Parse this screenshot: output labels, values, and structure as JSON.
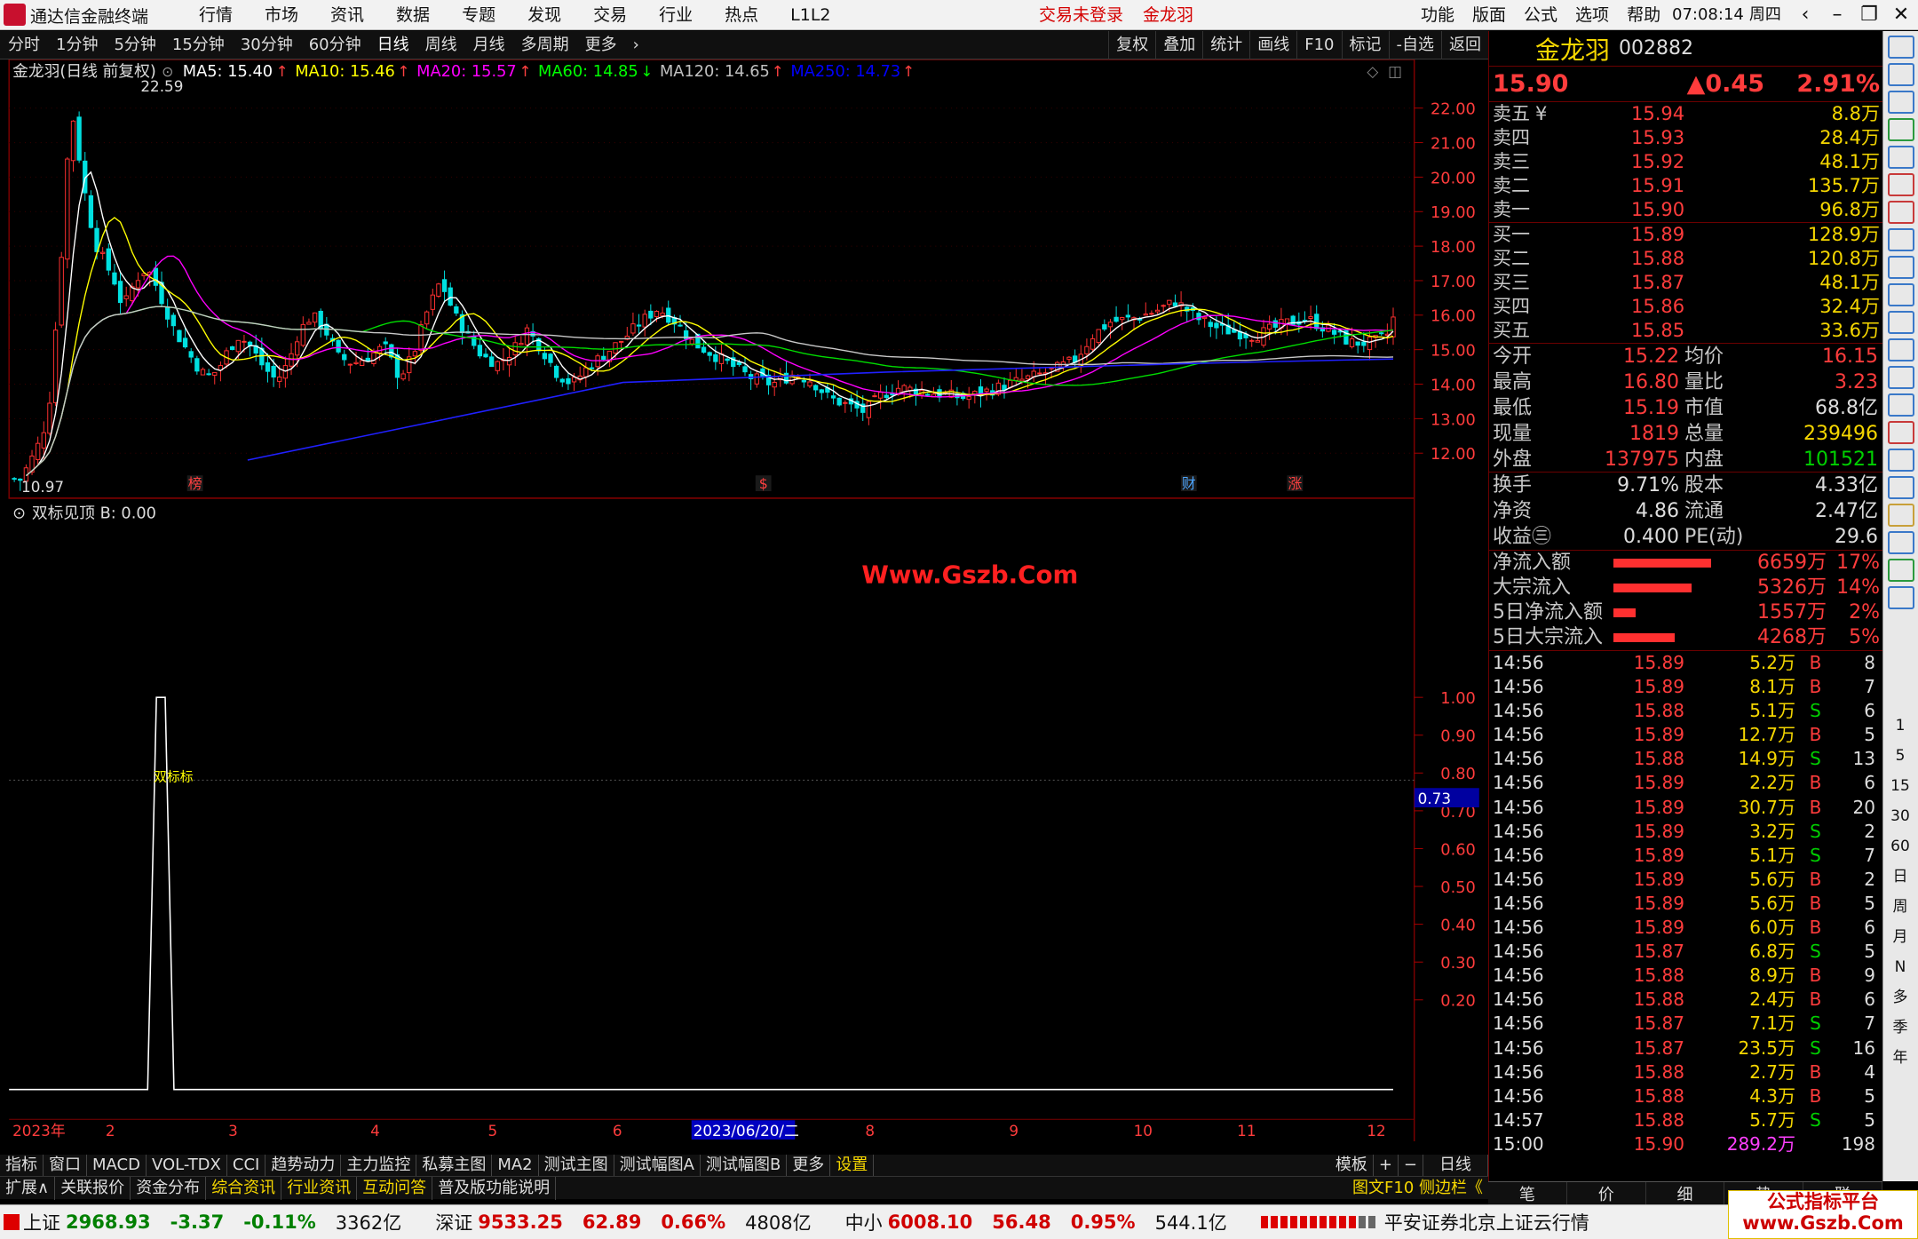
{
  "app": {
    "title": "通达信金融终端",
    "menu": [
      "行情",
      "市场",
      "资讯",
      "数据",
      "专题",
      "发现",
      "交易",
      "行业",
      "热点",
      "L1L2"
    ],
    "login_status": "交易未登录",
    "stock_name_top": "金龙羽",
    "right_menu": [
      "功能",
      "版面",
      "公式",
      "选项",
      "帮助"
    ],
    "clock": "07:08:14",
    "weekday": "周四"
  },
  "toolbar": {
    "periods": [
      "分时",
      "1分钟",
      "5分钟",
      "15分钟",
      "30分钟",
      "60分钟",
      "日线",
      "周线",
      "月线",
      "多周期",
      "更多"
    ],
    "active_period": "日线",
    "tools": [
      "复权",
      "叠加",
      "统计",
      "画线",
      "F10",
      "标记",
      "-自选",
      "返回"
    ]
  },
  "chart_data": [
    {
      "type": "candlestick",
      "title": "金龙羽(日线 前复权)",
      "ma_labels": [
        {
          "name": "MA5",
          "value": "15.40",
          "color": "#ffffff"
        },
        {
          "name": "MA10",
          "value": "15.46",
          "color": "#ffff00"
        },
        {
          "name": "MA20",
          "value": "15.57",
          "color": "#ff00ff"
        },
        {
          "name": "MA60",
          "value": "14.85",
          "color": "#00ff00"
        },
        {
          "name": "MA120",
          "value": "14.65",
          "color": "#c0c0c0"
        },
        {
          "name": "MA250",
          "value": "14.73",
          "color": "#0000ff"
        }
      ],
      "y_ticks": [
        "22.00",
        "21.00",
        "20.00",
        "19.00",
        "18.00",
        "17.00",
        "16.00",
        "15.00",
        "14.00",
        "13.00",
        "12.00"
      ],
      "ylim": [
        11.0,
        22.9
      ],
      "high_label": "22.59",
      "low_label": "10.97",
      "markers": [
        "榜",
        "$",
        "财",
        "涨"
      ],
      "x_labels": [
        "2023年",
        "2",
        "3",
        "4",
        "5",
        "6",
        "2023/06/20/二",
        "8",
        "9",
        "10",
        "11",
        "12"
      ]
    },
    {
      "type": "line",
      "title": "双标见顶",
      "value_label": "B: 0.00",
      "y_ticks": [
        "1.00",
        "0.90",
        "0.80",
        "0.70",
        "0.60",
        "0.50",
        "0.40",
        "0.30",
        "0.20"
      ],
      "ylim": [
        0,
        1.05
      ],
      "cursor_value": "0.73",
      "signal_label": "双标标"
    }
  ],
  "watermark": "Www.Gszb.Com",
  "quote": {
    "name": "金龙羽",
    "code": "002882",
    "price": "15.90",
    "change": "▲0.45",
    "pct": "2.91%"
  },
  "asks": [
    {
      "label": "卖五",
      "price": "15.94",
      "vol": "8.8万"
    },
    {
      "label": "卖四",
      "price": "15.93",
      "vol": "28.4万"
    },
    {
      "label": "卖三",
      "price": "15.92",
      "vol": "48.1万"
    },
    {
      "label": "卖二",
      "price": "15.91",
      "vol": "135.7万"
    },
    {
      "label": "卖一",
      "price": "15.90",
      "vol": "96.8万"
    }
  ],
  "bids": [
    {
      "label": "买一",
      "price": "15.89",
      "vol": "128.9万"
    },
    {
      "label": "买二",
      "price": "15.88",
      "vol": "120.8万"
    },
    {
      "label": "买三",
      "price": "15.87",
      "vol": "48.1万"
    },
    {
      "label": "买四",
      "price": "15.86",
      "vol": "32.4万"
    },
    {
      "label": "买五",
      "price": "15.85",
      "vol": "33.6万"
    }
  ],
  "yen_mark": "¥",
  "stats": [
    {
      "k": "今开",
      "v": "15.22",
      "vc": "#ff3c3c",
      "k2": "均价",
      "v2": "16.15",
      "v2c": "#ff3c3c"
    },
    {
      "k": "最高",
      "v": "16.80",
      "vc": "#ff3c3c",
      "k2": "量比",
      "v2": "3.23",
      "v2c": "#ff3c3c"
    },
    {
      "k": "最低",
      "v": "15.19",
      "vc": "#ff3c3c",
      "k2": "市值",
      "v2": "68.8亿",
      "v2c": "#ddd"
    },
    {
      "k": "现量",
      "v": "1819",
      "vc": "#ff3c3c",
      "k2": "总量",
      "v2": "239496",
      "v2c": "#f6d700"
    },
    {
      "k": "外盘",
      "v": "137975",
      "vc": "#ff3c3c",
      "k2": "内盘",
      "v2": "101521",
      "v2c": "#00d000"
    },
    {
      "k": "换手",
      "v": "9.71%",
      "vc": "#ddd",
      "k2": "股本",
      "v2": "4.33亿",
      "v2c": "#ddd"
    },
    {
      "k": "净资",
      "v": "4.86",
      "vc": "#ddd",
      "k2": "流通",
      "v2": "2.47亿",
      "v2c": "#ddd"
    },
    {
      "k": "收益㊂",
      "v": "0.400",
      "vc": "#ddd",
      "k2": "PE(动)",
      "v2": "29.6",
      "v2c": "#ddd"
    }
  ],
  "flows": [
    {
      "k": "净流入额",
      "v": "6659万",
      "p": "17%",
      "bar": 1.0
    },
    {
      "k": "大宗流入",
      "v": "5326万",
      "p": "14%",
      "bar": 0.8
    },
    {
      "k": "5日净流入额",
      "v": "1557万",
      "p": "2%",
      "bar": 0.23
    },
    {
      "k": "5日大宗流入",
      "v": "4268万",
      "p": "5%",
      "bar": 0.63
    }
  ],
  "ticks": [
    {
      "t": "14:56",
      "p": "15.89",
      "v": "5.2万",
      "bs": "B",
      "n": "8"
    },
    {
      "t": "14:56",
      "p": "15.89",
      "v": "8.1万",
      "bs": "B",
      "n": "7"
    },
    {
      "t": "14:56",
      "p": "15.88",
      "v": "5.1万",
      "bs": "S",
      "n": "6"
    },
    {
      "t": "14:56",
      "p": "15.89",
      "v": "12.7万",
      "bs": "B",
      "n": "5"
    },
    {
      "t": "14:56",
      "p": "15.88",
      "v": "14.9万",
      "bs": "S",
      "n": "13"
    },
    {
      "t": "14:56",
      "p": "15.89",
      "v": "2.2万",
      "bs": "B",
      "n": "6"
    },
    {
      "t": "14:56",
      "p": "15.89",
      "v": "30.7万",
      "bs": "B",
      "n": "20"
    },
    {
      "t": "14:56",
      "p": "15.89",
      "v": "3.2万",
      "bs": "S",
      "n": "2"
    },
    {
      "t": "14:56",
      "p": "15.89",
      "v": "5.1万",
      "bs": "S",
      "n": "7"
    },
    {
      "t": "14:56",
      "p": "15.89",
      "v": "5.6万",
      "bs": "B",
      "n": "2"
    },
    {
      "t": "14:56",
      "p": "15.89",
      "v": "5.6万",
      "bs": "B",
      "n": "5"
    },
    {
      "t": "14:56",
      "p": "15.89",
      "v": "6.0万",
      "bs": "B",
      "n": "6"
    },
    {
      "t": "14:56",
      "p": "15.87",
      "v": "6.8万",
      "bs": "S",
      "n": "5"
    },
    {
      "t": "14:56",
      "p": "15.88",
      "v": "8.9万",
      "bs": "B",
      "n": "9"
    },
    {
      "t": "14:56",
      "p": "15.88",
      "v": "2.4万",
      "bs": "B",
      "n": "6"
    },
    {
      "t": "14:56",
      "p": "15.87",
      "v": "7.1万",
      "bs": "S",
      "n": "7"
    },
    {
      "t": "14:56",
      "p": "15.87",
      "v": "23.5万",
      "bs": "S",
      "n": "16"
    },
    {
      "t": "14:56",
      "p": "15.88",
      "v": "2.7万",
      "bs": "B",
      "n": "4"
    },
    {
      "t": "14:56",
      "p": "15.88",
      "v": "4.3万",
      "bs": "B",
      "n": "5"
    },
    {
      "t": "14:57",
      "p": "15.88",
      "v": "5.7万",
      "bs": "S",
      "n": "5"
    },
    {
      "t": "15:00",
      "p": "15.90",
      "v": "289.2万",
      "bs": "",
      "n": "198"
    }
  ],
  "rp_bottom_tabs": [
    "笔",
    "价",
    "细",
    "势",
    "联"
  ],
  "bottom_tabs1": [
    "指标",
    "窗口",
    "MACD",
    "VOL-TDX",
    "CCI",
    "趋势动力",
    "主力监控",
    "私募主图",
    "MA2",
    "测试主图",
    "测试幅图A",
    "测试幅图B",
    "更多",
    "设置"
  ],
  "bottom_tabs1_right": [
    "模板",
    "+",
    "−"
  ],
  "period_label": "日线",
  "bottom_tabs2": [
    "扩展∧",
    "关联报价",
    "资金分布",
    "综合资讯",
    "行业资讯",
    "互动问答",
    "普及版功能说明"
  ],
  "bottom_tabs2_right": "图文F10 侧边栏《",
  "side_labels": [
    "日",
    "周",
    "月",
    "N",
    "多",
    "季",
    "年"
  ],
  "side_minutes": [
    "1",
    "5",
    "15",
    "30",
    "60"
  ],
  "status": [
    {
      "name": "上证",
      "value": "2968.93",
      "chg": "-3.37",
      "pct": "-0.11%",
      "amt": "3362亿",
      "dir": "dn"
    },
    {
      "name": "深证",
      "value": "9533.25",
      "chg": "62.89",
      "pct": "0.66%",
      "amt": "4808亿",
      "dir": "up"
    },
    {
      "name": "中小",
      "value": "6008.10",
      "chg": "56.48",
      "pct": "0.95%",
      "amt": "544.1亿",
      "dir": "up"
    }
  ],
  "status_server": "平安证券北京上证云行情",
  "corner_wm": {
    "line1": "公式指标平台",
    "line2": "www.Gszb.Com"
  }
}
